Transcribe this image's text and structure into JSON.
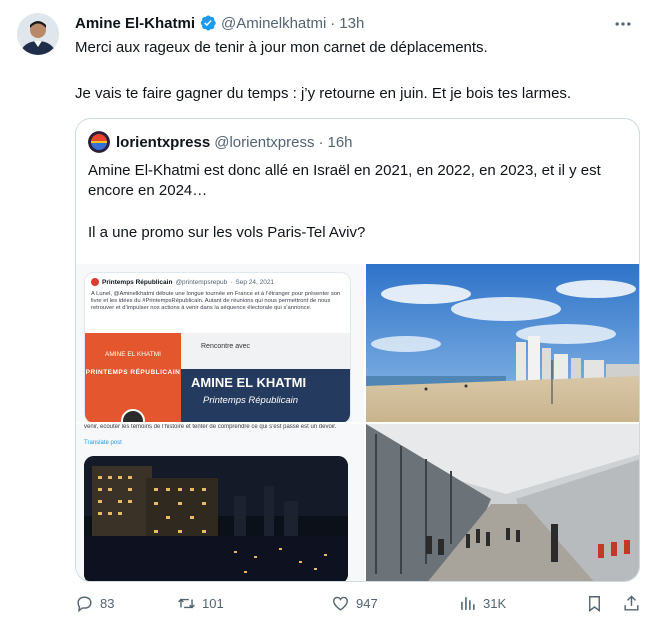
{
  "tweet": {
    "author_name": "Amine El-Khatmi",
    "author_handle": "@Aminelkhatmi",
    "separator": "·",
    "time": "13h",
    "text_1": "Merci aux rageux de tenir à jour mon carnet de déplacements.",
    "text_2": "Je vais te faire gagner du temps : j’y retourne en juin. Et je bois tes larmes."
  },
  "quote": {
    "author_name": "lorientxpress",
    "author_handle": "@lorientxpress",
    "separator": "·",
    "time": "16h",
    "text_1": "Amine El-Khatmi est donc allé en Israël en 2021, en 2022, en 2023, et il y est encore en 2024…",
    "text_2": "Il a une promo sur les vols Paris-Tel Aviv?"
  },
  "media_card": {
    "name": "Printemps Républicain",
    "handle": "@printempsrepub",
    "date": "Sep 24, 2021",
    "separator": "·",
    "body": "A Lunel, @Aminelkhatmi débute une longue tournée en France et à l’étranger pour présenter son livre et les idées du #PrintempsRépublicain. Autant de réunions qui nous permettront de nous retrouver et d’impulser nos actions à venir dans la séquence électorale qui s’annonce.",
    "poster_left_name": "AMINE EL KHATMI",
    "poster_left_brand": "PRINTEMPS RÉPUBLICAIN",
    "poster_right_intro": "Rencontre avec",
    "poster_right_name": "AMINE EL KHATMI",
    "poster_right_brand": "Printemps Républicain",
    "continuation": "venir, écouter les témoins de l’histoire et tenter de comprendre ce qui s’est passé est un devoir.",
    "translate": "Translate post"
  },
  "actions": {
    "replies": "83",
    "reposts": "101",
    "likes": "947",
    "views": "31K"
  },
  "colors": {
    "verified": "#1d9bf0",
    "muted_text": "#536471",
    "border": "#cfd9de"
  },
  "icons": [
    "verified-badge-icon",
    "more-icon",
    "reply-icon",
    "repost-icon",
    "like-icon",
    "views-icon",
    "bookmark-icon",
    "share-icon"
  ]
}
